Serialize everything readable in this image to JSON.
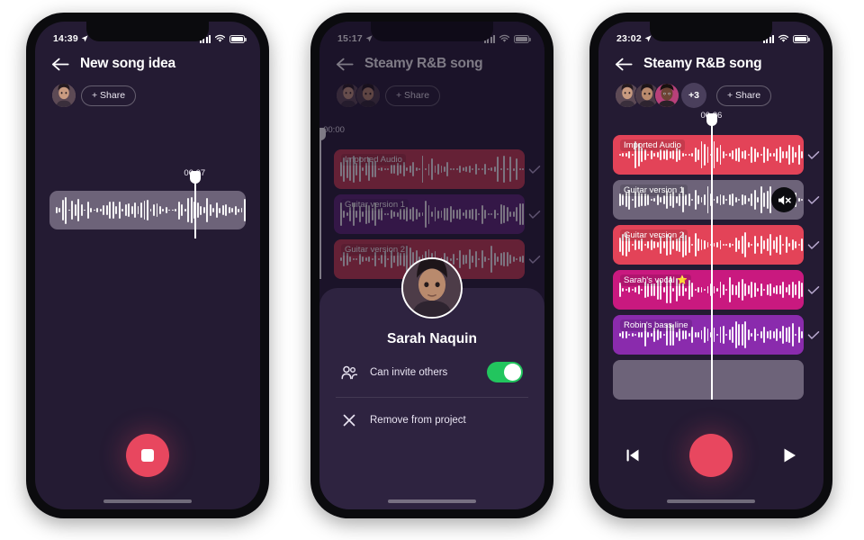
{
  "colors": {
    "screen_bg": "#241b33",
    "accent_red": "#e8475f",
    "track_red": "#e34358",
    "track_purple": "#6d2a8f",
    "track_magenta": "#c9197f",
    "track_violet": "#8a2bad",
    "track_muted_grey": "#6d6379",
    "toggle_on_green": "#22c55e"
  },
  "phones": [
    {
      "id": "phone-new-song",
      "status": {
        "time": "14:39",
        "location_icon": "location-arrow-icon",
        "signal_icon": "signal-bars-icon",
        "wifi_icon": "wifi-icon",
        "battery_icon": "battery-icon"
      },
      "header": {
        "back_icon": "back-arrow-icon",
        "title": "New song idea",
        "share_label": "+ Share",
        "avatar_count": 1,
        "more_badge": null
      },
      "solo_track": {
        "time_label": "00:07",
        "playhead_pct": 74
      },
      "transport": {
        "record_icon": "stop-record-button",
        "has_prev": false,
        "has_play": false
      }
    },
    {
      "id": "phone-member-sheet",
      "status": {
        "time": "15:17",
        "location_icon": "location-arrow-icon",
        "signal_icon": "signal-bars-icon",
        "wifi_icon": "wifi-icon",
        "battery_icon": "battery-icon"
      },
      "header": {
        "back_icon": "back-arrow-icon",
        "title": "Steamy R&B song",
        "share_label": "+ Share",
        "avatar_count": 2,
        "more_badge": null
      },
      "timeline": {
        "time_label": "00:00",
        "playhead_pct": 0
      },
      "tracks": [
        {
          "label": "Imported Audio",
          "color": "#c83a51",
          "muted": false,
          "checked": true,
          "empty": false
        },
        {
          "label": "Guitar version 1",
          "color": "#5b2577",
          "muted": false,
          "checked": true,
          "empty": false
        },
        {
          "label": "Guitar version 2",
          "color": "#c83a51",
          "muted": false,
          "checked": true,
          "empty": false
        }
      ],
      "sheet": {
        "name": "Sarah Naquin",
        "avatar_icon": "user-avatar",
        "rows": [
          {
            "icon": "people-icon",
            "label": "Can invite others",
            "control": "toggle",
            "value": true
          },
          {
            "icon": "close-x-icon",
            "label": "Remove from project",
            "control": "none"
          }
        ]
      }
    },
    {
      "id": "phone-multitrack",
      "status": {
        "time": "23:02",
        "location_icon": "location-arrow-icon",
        "signal_icon": "signal-bars-icon",
        "wifi_icon": "wifi-icon",
        "battery_icon": "battery-icon"
      },
      "header": {
        "back_icon": "back-arrow-icon",
        "title": "Steamy R&B song",
        "share_label": "+ Share",
        "avatar_count": 3,
        "more_badge": "+3"
      },
      "timeline": {
        "time_label": "00:26",
        "playhead_pct": 55
      },
      "tracks": [
        {
          "label": "Imported Audio",
          "color": "#e34358",
          "muted": false,
          "checked": true,
          "empty": false
        },
        {
          "label": "Guitar version 1",
          "color": "#6d6379",
          "muted": true,
          "mute_icon": "speaker-mute-icon",
          "checked": true,
          "empty": false
        },
        {
          "label": "Guitar version 2",
          "color": "#e34358",
          "muted": false,
          "checked": true,
          "empty": false
        },
        {
          "label": "Sarah's vocal ⭐",
          "color": "#c9197f",
          "muted": false,
          "checked": true,
          "empty": false
        },
        {
          "label": "Robin's bass line",
          "color": "#8a2bad",
          "muted": false,
          "checked": true,
          "empty": false
        },
        {
          "label": "",
          "color": "#6d6379",
          "muted": false,
          "checked": false,
          "empty": true
        }
      ],
      "transport": {
        "prev_icon": "skip-to-start-icon",
        "record_icon": "record-button",
        "play_icon": "play-icon",
        "has_prev": true,
        "has_play": true
      }
    }
  ]
}
